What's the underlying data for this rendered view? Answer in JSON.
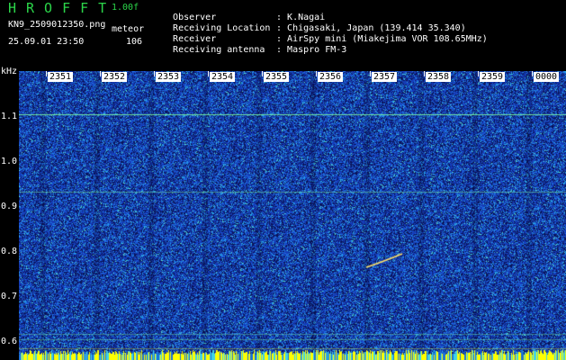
{
  "header": {
    "brand": "HROFFT",
    "version": "1.00f",
    "filename": "KN9_2509012350.png",
    "mode": "meteor",
    "datetime": "25.09.01 23:50",
    "count": "106"
  },
  "info": [
    {
      "label": "Observer",
      "value": "K.Nagai"
    },
    {
      "label": "Receiving Location",
      "value": "Chigasaki, Japan (139.414 35.340)"
    },
    {
      "label": "Receiver",
      "value": "AirSpy mini (Miakejima VOR 108.65MHz)"
    },
    {
      "label": "Receiving antenna",
      "value": "Maspro FM-3"
    }
  ],
  "axis": {
    "unit": "kHz",
    "y_ticks": [
      "1.1",
      "1.0",
      "0.9",
      "0.8",
      "0.7",
      "0.6"
    ],
    "time_labels": [
      "2351",
      "2352",
      "2353",
      "2354",
      "2355",
      "2356",
      "2357",
      "2358",
      "2359",
      "0000"
    ]
  },
  "colors": {
    "noise_bg": "#1a3fa8",
    "signal_line": "#6fe3a0",
    "meteor": "#ffe066",
    "baseline": "#ffff00"
  }
}
